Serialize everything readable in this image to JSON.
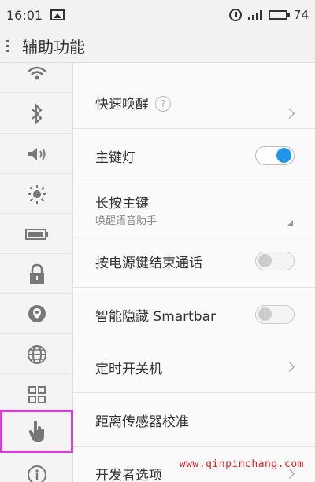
{
  "status_bar": {
    "time": "16:01",
    "battery": "74"
  },
  "header": {
    "title": "辅助功能"
  },
  "sidebar": {
    "items": [
      {
        "icon": "wifi-icon"
      },
      {
        "icon": "bluetooth-icon"
      },
      {
        "icon": "volume-icon"
      },
      {
        "icon": "brightness-icon"
      },
      {
        "icon": "battery-icon"
      },
      {
        "icon": "lock-icon"
      },
      {
        "icon": "location-icon"
      },
      {
        "icon": "globe-icon"
      },
      {
        "icon": "apps-grid-icon"
      },
      {
        "icon": "hand-pointer-icon",
        "selected": true
      },
      {
        "icon": "info-icon"
      }
    ],
    "selected_color": "#d63fd6"
  },
  "settings": {
    "quick_wake": {
      "label": "快速唤醒",
      "help": "?"
    },
    "home_key_light": {
      "label": "主键灯",
      "enabled": true
    },
    "long_press_home": {
      "label": "长按主键",
      "value": "唤醒语音助手"
    },
    "power_end_call": {
      "label": "按电源键结束通话",
      "enabled": false
    },
    "smart_hide_smartbar": {
      "label": "智能隐藏 Smartbar",
      "enabled": false
    },
    "scheduled_power": {
      "label": "定时开关机"
    },
    "proximity_calibration": {
      "label": "距离传感器校准"
    },
    "developer_options": {
      "label": "开发者选项"
    }
  },
  "accent_color": "#2196e8",
  "watermark": "www.qinpinchang.com"
}
